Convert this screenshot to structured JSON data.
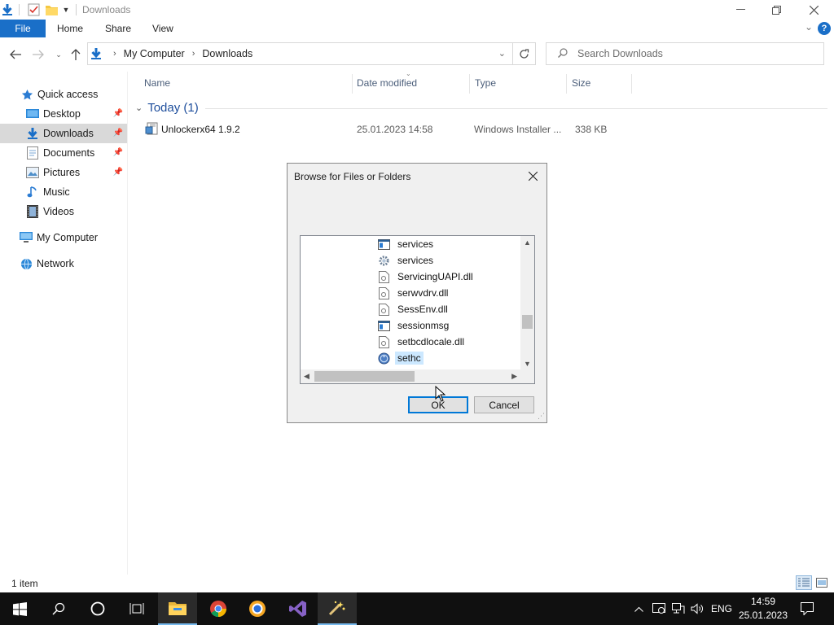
{
  "window": {
    "title": "Downloads"
  },
  "ribbon": {
    "file": "File",
    "tabs": [
      "Home",
      "Share",
      "View"
    ]
  },
  "address": {
    "crumbs": [
      "My Computer",
      "Downloads"
    ],
    "search_placeholder": "Search Downloads"
  },
  "sidebar": {
    "items": [
      {
        "label": "Quick access",
        "icon": "star-icon"
      },
      {
        "label": "Desktop",
        "icon": "desktop-icon",
        "pinned": true
      },
      {
        "label": "Downloads",
        "icon": "download-icon",
        "pinned": true,
        "selected": true
      },
      {
        "label": "Documents",
        "icon": "documents-icon",
        "pinned": true
      },
      {
        "label": "Pictures",
        "icon": "pictures-icon",
        "pinned": true
      },
      {
        "label": "Music",
        "icon": "music-icon"
      },
      {
        "label": "Videos",
        "icon": "videos-icon"
      },
      {
        "label": "My Computer",
        "icon": "computer-icon"
      },
      {
        "label": "Network",
        "icon": "network-icon"
      }
    ]
  },
  "columns": {
    "name": "Name",
    "date": "Date modified",
    "type": "Type",
    "size": "Size"
  },
  "group": {
    "label": "Today (1)"
  },
  "files": [
    {
      "name": "Unlockerx64 1.9.2",
      "date": "25.01.2023 14:58",
      "type": "Windows Installer ...",
      "size": "338 KB"
    }
  ],
  "status": {
    "count": "1 item"
  },
  "dialog": {
    "title": "Browse for Files or Folders",
    "items": [
      {
        "label": "services",
        "icon": "window-file-icon"
      },
      {
        "label": "services",
        "icon": "gear-file-icon"
      },
      {
        "label": "ServicingUAPI.dll",
        "icon": "dll-file-icon"
      },
      {
        "label": "serwvdrv.dll",
        "icon": "dll-file-icon"
      },
      {
        "label": "SessEnv.dll",
        "icon": "dll-file-icon"
      },
      {
        "label": "sessionmsg",
        "icon": "window-file-icon"
      },
      {
        "label": "setbcdlocale.dll",
        "icon": "dll-file-icon"
      },
      {
        "label": "sethc",
        "icon": "accessibility-icon",
        "selected": true
      }
    ],
    "ok": "OK",
    "cancel": "Cancel"
  },
  "taskbar": {
    "language": "ENG",
    "time": "14:59",
    "date": "25.01.2023"
  },
  "colors": {
    "accent": "#1a6fc8",
    "selection": "#cce8ff",
    "taskbar": "#101010"
  }
}
